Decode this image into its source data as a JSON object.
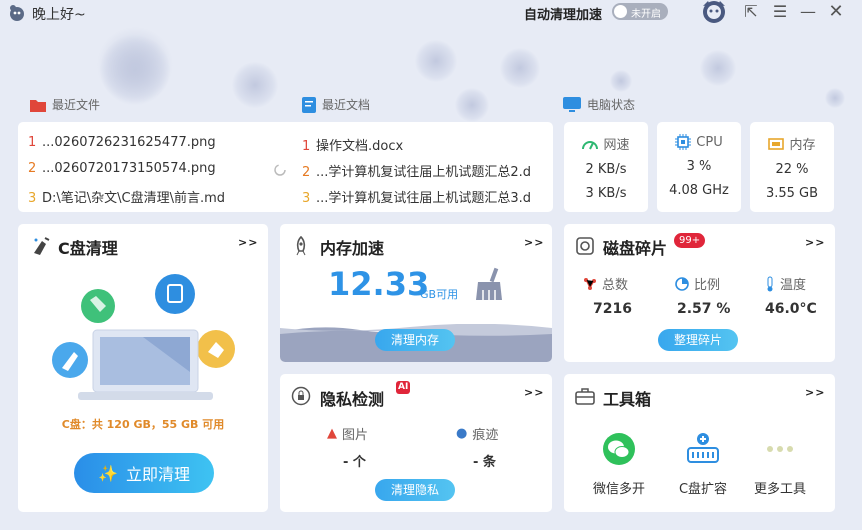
{
  "titlebar": {
    "greeting": "晚上好~",
    "auto_clean_label": "自动清理加速",
    "toggle_text": "未开启"
  },
  "sections": {
    "recent_files": "最近文件",
    "recent_docs": "最近文档",
    "pc_status": "电脑状态"
  },
  "recent_files": [
    {
      "num": "1",
      "name": "...0260726231625477.png"
    },
    {
      "num": "2",
      "name": "...0260720173150574.png"
    },
    {
      "num": "3",
      "name": "D:\\笔记\\杂文\\C盘清理\\前言.md"
    }
  ],
  "recent_docs": [
    {
      "num": "1",
      "name": "操作文档.docx"
    },
    {
      "num": "2",
      "name": "...学计算机复试往届上机试题汇总2.d"
    },
    {
      "num": "3",
      "name": "...学计算机复试往届上机试题汇总3.d"
    }
  ],
  "status": {
    "network": {
      "label": "网速",
      "up": "2 KB/s",
      "down": "3 KB/s"
    },
    "cpu": {
      "label": "CPU",
      "usage": "3 %",
      "freq": "4.08 GHz"
    },
    "memory": {
      "label": "内存",
      "usage": "22 %",
      "size": "3.55 GB"
    }
  },
  "c_clean": {
    "title": "C盘清理",
    "more": ">>",
    "disk_info": "C盘：共 120 GB，55 GB 可用",
    "button": "立即清理"
  },
  "mem_boost": {
    "title": "内存加速",
    "more": ">>",
    "value": "12.33",
    "unit": "GB可用",
    "button": "清理内存"
  },
  "defrag": {
    "title": "磁盘碎片",
    "badge": "99+",
    "more": ">>",
    "total_label": "总数",
    "total": "7216",
    "ratio_label": "比例",
    "ratio": "2.57 %",
    "temp_label": "温度",
    "temp": "46.0°C",
    "button": "整理碎片"
  },
  "privacy": {
    "title": "隐私检测",
    "ai_badge": "AI",
    "more": ">>",
    "pic_label": "图片",
    "pic_value": "- 个",
    "trace_label": "痕迹",
    "trace_value": "- 条",
    "button": "清理隐私"
  },
  "toolbox": {
    "title": "工具箱",
    "more": ">>",
    "items": [
      {
        "label": "微信多开"
      },
      {
        "label": "C盘扩容"
      },
      {
        "label": "更多工具"
      }
    ]
  },
  "colors": {
    "accent": "#3aa6ee",
    "hot": "#e0463a",
    "bg": "#e7ebf5"
  }
}
